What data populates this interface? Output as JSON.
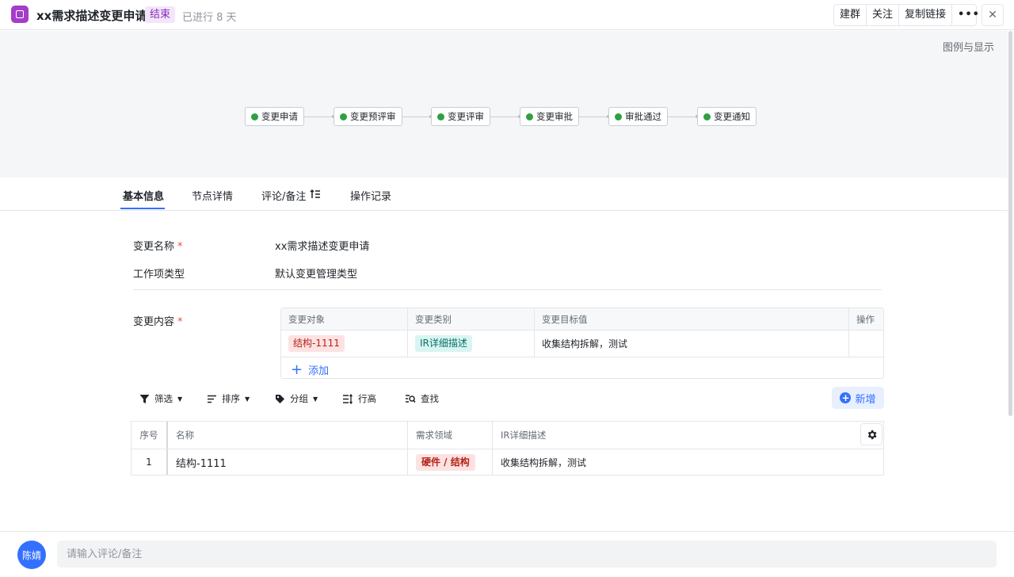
{
  "header": {
    "title": "xx需求描述变更申请",
    "status": "结束",
    "elapsed": "已进行 8 天",
    "actions": [
      "建群",
      "关注",
      "复制链接"
    ],
    "more_label": "•••",
    "close_label": "✕"
  },
  "flow": {
    "legend_label": "图例与显示",
    "nodes": [
      "变更申请",
      "变更预评审",
      "变更评审",
      "变更审批",
      "审批通过",
      "变更通知"
    ]
  },
  "tabs": [
    "基本信息",
    "节点详情",
    "评论/备注",
    "操作记录"
  ],
  "form": {
    "name_label": "变更名称",
    "name_value": "xx需求描述变更申请",
    "type_label": "工作项类型",
    "type_value": "默认变更管理类型",
    "content_label": "变更内容",
    "required_mark": "*"
  },
  "change_table": {
    "headers": [
      "变更对象",
      "变更类别",
      "变更目标值",
      "操作"
    ],
    "row": {
      "object": "结构-1111",
      "category": "IR详细描述",
      "target": "收集结构拆解，测试",
      "op": ""
    },
    "add_label": "添加"
  },
  "toolbar": {
    "filter": "筛选",
    "sort": "排序",
    "group": "分组",
    "row_height": "行高",
    "find": "查找",
    "new_label": "新增"
  },
  "data_table": {
    "headers": [
      "序号",
      "名称",
      "需求领域",
      "IR详细描述"
    ],
    "rows": [
      {
        "seq": "1",
        "name": "结构-1111",
        "domain": "硬件 / 结构",
        "desc": "收集结构拆解，测试"
      }
    ]
  },
  "comment": {
    "avatar_text": "陈婧",
    "placeholder": "请输入评论/备注"
  },
  "colors": {
    "accent": "#3370ff",
    "status_purple": "#8a2cb8",
    "node_green": "#2ea043",
    "tag_red": "#b42318"
  }
}
